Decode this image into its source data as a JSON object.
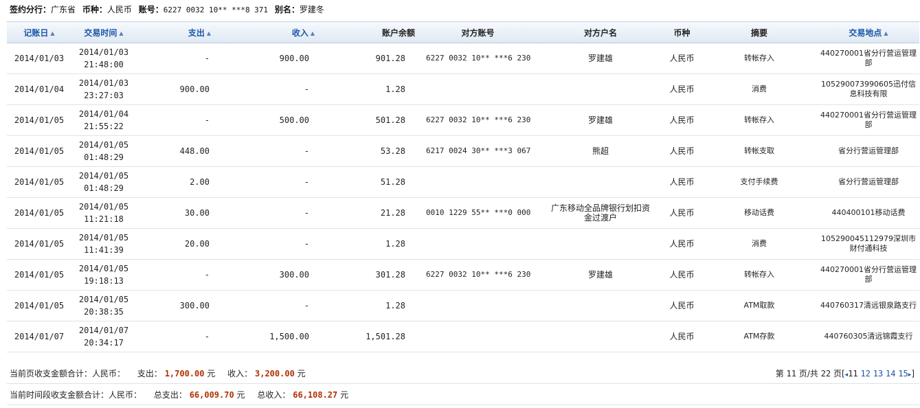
{
  "account_info": {
    "branch_label": "签约分行：",
    "branch_value": "广东省",
    "currency_label": "币种：",
    "currency_value": "人民币",
    "account_label": "账号：",
    "account_value": "6227 0032 10** ***8 371",
    "alias_label": "别名：",
    "alias_value": "罗建冬"
  },
  "columns": [
    {
      "key": "record_date",
      "label": "记账日",
      "sortable": true
    },
    {
      "key": "txn_time",
      "label": "交易时间",
      "sortable": true
    },
    {
      "key": "expense",
      "label": "支出",
      "sortable": true
    },
    {
      "key": "income",
      "label": "收入",
      "sortable": true
    },
    {
      "key": "balance",
      "label": "账户余额",
      "sortable": false
    },
    {
      "key": "counter_account",
      "label": "对方账号",
      "sortable": false
    },
    {
      "key": "counter_name",
      "label": "对方户名",
      "sortable": false
    },
    {
      "key": "currency",
      "label": "币种",
      "sortable": false
    },
    {
      "key": "summary",
      "label": "摘要",
      "sortable": false
    },
    {
      "key": "location",
      "label": "交易地点",
      "sortable": true
    }
  ],
  "rows": [
    {
      "record_date": "2014/01/03",
      "txn_date": "2014/01/03",
      "txn_clock": "21:48:00",
      "expense": "-",
      "income": "900.00",
      "balance": "901.28",
      "counter_account": "6227 0032 10** ***6 230",
      "counter_name": "罗建雄",
      "currency": "人民币",
      "summary": "转帐存入",
      "location": "440270001省分行营运管理部"
    },
    {
      "record_date": "2014/01/04",
      "txn_date": "2014/01/03",
      "txn_clock": "23:27:03",
      "expense": "900.00",
      "income": "-",
      "balance": "1.28",
      "counter_account": "",
      "counter_name": "",
      "currency": "人民币",
      "summary": "消费",
      "location": "105290073990605迅付信息科技有限"
    },
    {
      "record_date": "2014/01/05",
      "txn_date": "2014/01/04",
      "txn_clock": "21:55:22",
      "expense": "-",
      "income": "500.00",
      "balance": "501.28",
      "counter_account": "6227 0032 10** ***6 230",
      "counter_name": "罗建雄",
      "currency": "人民币",
      "summary": "转帐存入",
      "location": "440270001省分行营运管理部"
    },
    {
      "record_date": "2014/01/05",
      "txn_date": "2014/01/05",
      "txn_clock": "01:48:29",
      "expense": "448.00",
      "income": "-",
      "balance": "53.28",
      "counter_account": "6217 0024 30** ***3 067",
      "counter_name": "熊超",
      "currency": "人民币",
      "summary": "转帐支取",
      "location": "省分行营运管理部"
    },
    {
      "record_date": "2014/01/05",
      "txn_date": "2014/01/05",
      "txn_clock": "01:48:29",
      "expense": "2.00",
      "income": "-",
      "balance": "51.28",
      "counter_account": "",
      "counter_name": "",
      "currency": "人民币",
      "summary": "支付手续费",
      "location": "省分行营运管理部"
    },
    {
      "record_date": "2014/01/05",
      "txn_date": "2014/01/05",
      "txn_clock": "11:21:18",
      "expense": "30.00",
      "income": "-",
      "balance": "21.28",
      "counter_account": "0010 1229 55** ***0 000",
      "counter_name": "广东移动全品牌银行划扣资金过渡户",
      "currency": "人民币",
      "summary": "移动话费",
      "location": "440400101移动话费"
    },
    {
      "record_date": "2014/01/05",
      "txn_date": "2014/01/05",
      "txn_clock": "11:41:39",
      "expense": "20.00",
      "income": "-",
      "balance": "1.28",
      "counter_account": "",
      "counter_name": "",
      "currency": "人民币",
      "summary": "消费",
      "location": "105290045112979深圳市财付通科技"
    },
    {
      "record_date": "2014/01/05",
      "txn_date": "2014/01/05",
      "txn_clock": "19:18:13",
      "expense": "-",
      "income": "300.00",
      "balance": "301.28",
      "counter_account": "6227 0032 10** ***6 230",
      "counter_name": "罗建雄",
      "currency": "人民币",
      "summary": "转帐存入",
      "location": "440270001省分行营运管理部"
    },
    {
      "record_date": "2014/01/05",
      "txn_date": "2014/01/05",
      "txn_clock": "20:38:35",
      "expense": "300.00",
      "income": "-",
      "balance": "1.28",
      "counter_account": "",
      "counter_name": "",
      "currency": "人民币",
      "summary": "ATM取款",
      "location": "440760317清远银泉路支行"
    },
    {
      "record_date": "2014/01/07",
      "txn_date": "2014/01/07",
      "txn_clock": "20:34:17",
      "expense": "-",
      "income": "1,500.00",
      "balance": "1,501.28",
      "counter_account": "",
      "counter_name": "",
      "currency": "人民币",
      "summary": "ATM存款",
      "location": "440760305清远锦霞支行"
    }
  ],
  "page_summary": {
    "label": "当前页收支金额合计：人民币：",
    "expense_label": "支出：",
    "expense_value": "1,700.00",
    "expense_unit": "元",
    "income_label": "收入：",
    "income_value": "3,200.00",
    "income_unit": "元"
  },
  "period_summary": {
    "label": "当前时间段收支金额合计：人民币：",
    "expense_label": "总支出：",
    "expense_value": "66,009.70",
    "expense_unit": "元",
    "income_label": "总收入：",
    "income_value": "66,108.27",
    "income_unit": "元"
  },
  "pager": {
    "prefix": "第",
    "current_page": "11",
    "mid": "页/共",
    "total_pages": "22",
    "suffix": "页[",
    "prev_arrow": "◂",
    "pages": [
      "11",
      "12",
      "13",
      "14",
      "15"
    ],
    "next_arrow": "▸",
    "close": "]"
  },
  "colors": {
    "header_link": "#1a56a8",
    "amount": "#b03000",
    "header_bg": "#dfe8f3"
  }
}
